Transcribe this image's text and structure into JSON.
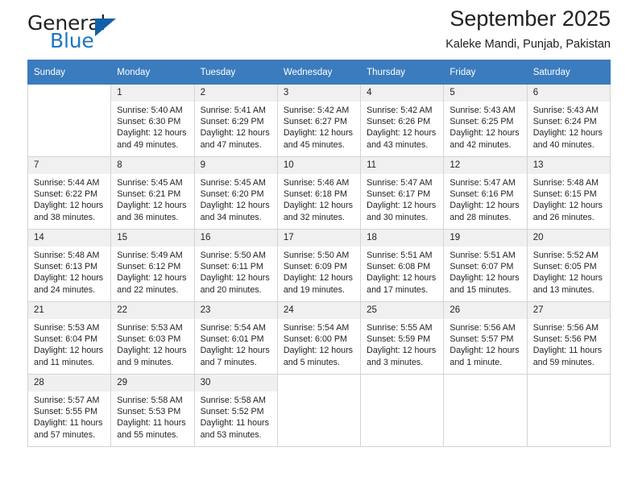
{
  "brand": {
    "name_top": "General",
    "name_bottom": "Blue",
    "accent_color": "#1c77c3",
    "triangle_color": "#1060a8"
  },
  "header": {
    "title": "September 2025",
    "subtitle": "Kaleke Mandi, Punjab, Pakistan"
  },
  "calendar": {
    "header_bg": "#3a7cbe",
    "daynum_bg": "#f0f0f0",
    "weekday_labels": [
      "Sunday",
      "Monday",
      "Tuesday",
      "Wednesday",
      "Thursday",
      "Friday",
      "Saturday"
    ],
    "labels": {
      "sunrise": "Sunrise:",
      "sunset": "Sunset:",
      "daylight": "Daylight:"
    },
    "weeks": [
      [
        {
          "day": "",
          "empty": true
        },
        {
          "day": "1",
          "sunrise": "Sunrise: 5:40 AM",
          "sunset": "Sunset: 6:30 PM",
          "daylight_1": "Daylight: 12 hours",
          "daylight_2": "and 49 minutes."
        },
        {
          "day": "2",
          "sunrise": "Sunrise: 5:41 AM",
          "sunset": "Sunset: 6:29 PM",
          "daylight_1": "Daylight: 12 hours",
          "daylight_2": "and 47 minutes."
        },
        {
          "day": "3",
          "sunrise": "Sunrise: 5:42 AM",
          "sunset": "Sunset: 6:27 PM",
          "daylight_1": "Daylight: 12 hours",
          "daylight_2": "and 45 minutes."
        },
        {
          "day": "4",
          "sunrise": "Sunrise: 5:42 AM",
          "sunset": "Sunset: 6:26 PM",
          "daylight_1": "Daylight: 12 hours",
          "daylight_2": "and 43 minutes."
        },
        {
          "day": "5",
          "sunrise": "Sunrise: 5:43 AM",
          "sunset": "Sunset: 6:25 PM",
          "daylight_1": "Daylight: 12 hours",
          "daylight_2": "and 42 minutes."
        },
        {
          "day": "6",
          "sunrise": "Sunrise: 5:43 AM",
          "sunset": "Sunset: 6:24 PM",
          "daylight_1": "Daylight: 12 hours",
          "daylight_2": "and 40 minutes."
        }
      ],
      [
        {
          "day": "7",
          "sunrise": "Sunrise: 5:44 AM",
          "sunset": "Sunset: 6:22 PM",
          "daylight_1": "Daylight: 12 hours",
          "daylight_2": "and 38 minutes."
        },
        {
          "day": "8",
          "sunrise": "Sunrise: 5:45 AM",
          "sunset": "Sunset: 6:21 PM",
          "daylight_1": "Daylight: 12 hours",
          "daylight_2": "and 36 minutes."
        },
        {
          "day": "9",
          "sunrise": "Sunrise: 5:45 AM",
          "sunset": "Sunset: 6:20 PM",
          "daylight_1": "Daylight: 12 hours",
          "daylight_2": "and 34 minutes."
        },
        {
          "day": "10",
          "sunrise": "Sunrise: 5:46 AM",
          "sunset": "Sunset: 6:18 PM",
          "daylight_1": "Daylight: 12 hours",
          "daylight_2": "and 32 minutes."
        },
        {
          "day": "11",
          "sunrise": "Sunrise: 5:47 AM",
          "sunset": "Sunset: 6:17 PM",
          "daylight_1": "Daylight: 12 hours",
          "daylight_2": "and 30 minutes."
        },
        {
          "day": "12",
          "sunrise": "Sunrise: 5:47 AM",
          "sunset": "Sunset: 6:16 PM",
          "daylight_1": "Daylight: 12 hours",
          "daylight_2": "and 28 minutes."
        },
        {
          "day": "13",
          "sunrise": "Sunrise: 5:48 AM",
          "sunset": "Sunset: 6:15 PM",
          "daylight_1": "Daylight: 12 hours",
          "daylight_2": "and 26 minutes."
        }
      ],
      [
        {
          "day": "14",
          "sunrise": "Sunrise: 5:48 AM",
          "sunset": "Sunset: 6:13 PM",
          "daylight_1": "Daylight: 12 hours",
          "daylight_2": "and 24 minutes."
        },
        {
          "day": "15",
          "sunrise": "Sunrise: 5:49 AM",
          "sunset": "Sunset: 6:12 PM",
          "daylight_1": "Daylight: 12 hours",
          "daylight_2": "and 22 minutes."
        },
        {
          "day": "16",
          "sunrise": "Sunrise: 5:50 AM",
          "sunset": "Sunset: 6:11 PM",
          "daylight_1": "Daylight: 12 hours",
          "daylight_2": "and 20 minutes."
        },
        {
          "day": "17",
          "sunrise": "Sunrise: 5:50 AM",
          "sunset": "Sunset: 6:09 PM",
          "daylight_1": "Daylight: 12 hours",
          "daylight_2": "and 19 minutes."
        },
        {
          "day": "18",
          "sunrise": "Sunrise: 5:51 AM",
          "sunset": "Sunset: 6:08 PM",
          "daylight_1": "Daylight: 12 hours",
          "daylight_2": "and 17 minutes."
        },
        {
          "day": "19",
          "sunrise": "Sunrise: 5:51 AM",
          "sunset": "Sunset: 6:07 PM",
          "daylight_1": "Daylight: 12 hours",
          "daylight_2": "and 15 minutes."
        },
        {
          "day": "20",
          "sunrise": "Sunrise: 5:52 AM",
          "sunset": "Sunset: 6:05 PM",
          "daylight_1": "Daylight: 12 hours",
          "daylight_2": "and 13 minutes."
        }
      ],
      [
        {
          "day": "21",
          "sunrise": "Sunrise: 5:53 AM",
          "sunset": "Sunset: 6:04 PM",
          "daylight_1": "Daylight: 12 hours",
          "daylight_2": "and 11 minutes."
        },
        {
          "day": "22",
          "sunrise": "Sunrise: 5:53 AM",
          "sunset": "Sunset: 6:03 PM",
          "daylight_1": "Daylight: 12 hours",
          "daylight_2": "and 9 minutes."
        },
        {
          "day": "23",
          "sunrise": "Sunrise: 5:54 AM",
          "sunset": "Sunset: 6:01 PM",
          "daylight_1": "Daylight: 12 hours",
          "daylight_2": "and 7 minutes."
        },
        {
          "day": "24",
          "sunrise": "Sunrise: 5:54 AM",
          "sunset": "Sunset: 6:00 PM",
          "daylight_1": "Daylight: 12 hours",
          "daylight_2": "and 5 minutes."
        },
        {
          "day": "25",
          "sunrise": "Sunrise: 5:55 AM",
          "sunset": "Sunset: 5:59 PM",
          "daylight_1": "Daylight: 12 hours",
          "daylight_2": "and 3 minutes."
        },
        {
          "day": "26",
          "sunrise": "Sunrise: 5:56 AM",
          "sunset": "Sunset: 5:57 PM",
          "daylight_1": "Daylight: 12 hours",
          "daylight_2": "and 1 minute."
        },
        {
          "day": "27",
          "sunrise": "Sunrise: 5:56 AM",
          "sunset": "Sunset: 5:56 PM",
          "daylight_1": "Daylight: 11 hours",
          "daylight_2": "and 59 minutes."
        }
      ],
      [
        {
          "day": "28",
          "sunrise": "Sunrise: 5:57 AM",
          "sunset": "Sunset: 5:55 PM",
          "daylight_1": "Daylight: 11 hours",
          "daylight_2": "and 57 minutes."
        },
        {
          "day": "29",
          "sunrise": "Sunrise: 5:58 AM",
          "sunset": "Sunset: 5:53 PM",
          "daylight_1": "Daylight: 11 hours",
          "daylight_2": "and 55 minutes."
        },
        {
          "day": "30",
          "sunrise": "Sunrise: 5:58 AM",
          "sunset": "Sunset: 5:52 PM",
          "daylight_1": "Daylight: 11 hours",
          "daylight_2": "and 53 minutes."
        },
        {
          "day": "",
          "empty": true
        },
        {
          "day": "",
          "empty": true
        },
        {
          "day": "",
          "empty": true
        },
        {
          "day": "",
          "empty": true
        }
      ]
    ]
  }
}
